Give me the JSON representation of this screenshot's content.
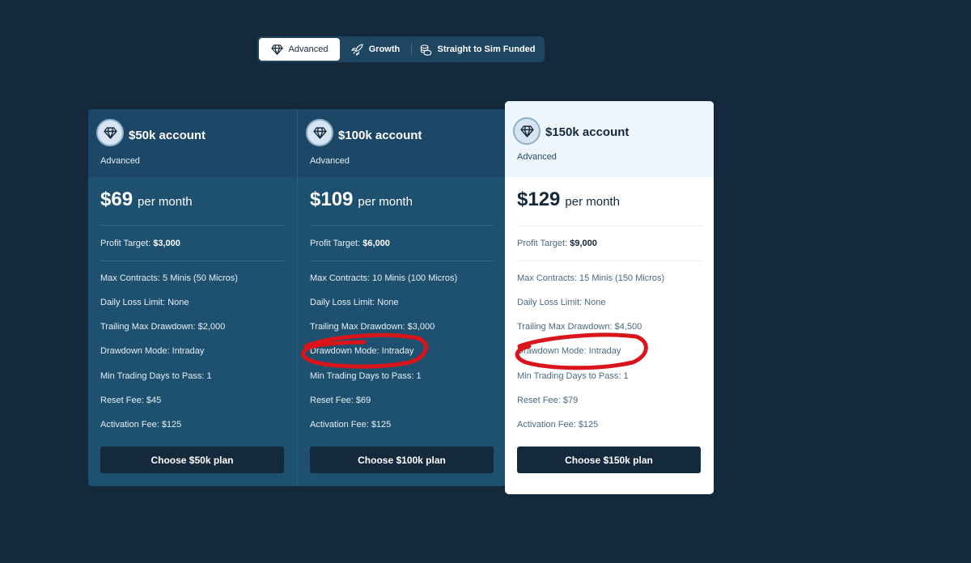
{
  "tabs": [
    {
      "label": "Advanced",
      "icon": "diamond-icon"
    },
    {
      "label": "Growth",
      "icon": "rocket-icon"
    },
    {
      "label": "Straight to Sim Funded",
      "icon": "coins-icon"
    }
  ],
  "plans": [
    {
      "title": "$50k account",
      "subtitle": "Advanced",
      "price": "$69",
      "per": "per month",
      "profit_label": "Profit Target: ",
      "profit_value": "$3,000",
      "max_contracts": "Max Contracts: 5 Minis (50 Micros)",
      "daily_loss": "Daily Loss Limit: None",
      "trailing": "Trailing Max Drawdown: $2,000",
      "drawdown_mode": "Drawdown Mode: Intraday",
      "min_days": "Min Trading Days to Pass: 1",
      "reset_fee": "Reset Fee: $45",
      "activation_fee": "Activation Fee: $125",
      "button": "Choose $50k plan"
    },
    {
      "title": "$100k account",
      "subtitle": "Advanced",
      "price": "$109",
      "per": "per month",
      "profit_label": "Profit Target: ",
      "profit_value": "$6,000",
      "max_contracts": "Max Contracts: 10 Minis (100 Micros)",
      "daily_loss": "Daily Loss Limit: None",
      "trailing": "Trailing Max Drawdown: $3,000",
      "drawdown_mode": "Drawdown Mode: Intraday",
      "min_days": "Min Trading Days to Pass: 1",
      "reset_fee": "Reset Fee: $69",
      "activation_fee": "Activation Fee: $125",
      "button": "Choose $100k plan"
    },
    {
      "title": "$150k account",
      "subtitle": "Advanced",
      "price": "$129",
      "per": "per month",
      "profit_label": "Profit Target: ",
      "profit_value": "$9,000",
      "max_contracts": "Max Contracts: 15 Minis (150 Micros)",
      "daily_loss": "Daily Loss Limit: None",
      "trailing": "Trailing Max Drawdown: $4,500",
      "drawdown_mode": "Drawdown Mode: Intraday",
      "min_days": "Min Trading Days to Pass: 1",
      "reset_fee": "Reset Fee: $79",
      "activation_fee": "Activation Fee: $125",
      "button": "Choose $150k plan"
    }
  ],
  "colors": {
    "background": "#14293b",
    "card": "#1e5170",
    "card_header": "#1d4766",
    "highlight_card": "#ffffff",
    "annotation": "#d9141b"
  }
}
